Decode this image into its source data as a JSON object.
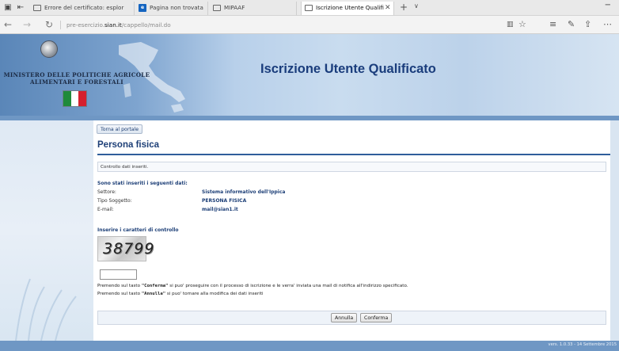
{
  "browser": {
    "tabs": [
      {
        "label": "Errore del certificato: esplor",
        "active": false
      },
      {
        "label": "Pagina non trovata",
        "active": false
      },
      {
        "label": "MIPAAF",
        "active": false
      },
      {
        "label": "Iscrizione Utente Qualifi",
        "active": true
      }
    ],
    "url_prefix": "pre-esercizio.",
    "url_domain": "sian.it",
    "url_path": "/cappello/mail.do",
    "icons": {
      "back": "back-arrow-icon",
      "forward": "forward-arrow-icon",
      "refresh": "refresh-icon",
      "reading_view": "reading-view-icon",
      "favorites": "star-icon",
      "hub": "hub-icon",
      "notes": "pen-icon",
      "share": "share-icon",
      "more": "more-icon"
    }
  },
  "banner": {
    "ministry_line1": "MINISTERO DELLE POLITICHE AGRICOLE",
    "ministry_line2": "ALIMENTARI E FORESTALI",
    "title": "Iscrizione Utente Qualificato",
    "flag_colors": [
      "#1f8a3a",
      "#ffffff",
      "#d5202d"
    ]
  },
  "page": {
    "portal_button": "Torna al portale",
    "section_title": "Persona fisica",
    "notice": "Controllo dati inseriti.",
    "summary_head": "Sono stati inseriti i seguenti dati:",
    "rows": [
      {
        "label": "Settore:",
        "value": "Sistema informativo dell'Ippica"
      },
      {
        "label": "Tipo Soggetto:",
        "value": "PERSONA FISICA"
      },
      {
        "label": "E-mail:",
        "value": "mail@sian1.it"
      }
    ],
    "captcha_head": "Inserire i caratteri di controllo",
    "captcha_text": "38799",
    "captcha_value": "",
    "help1_pre": "Premendo sul tasto ",
    "help1_key": "\"Conferma\"",
    "help1_post": " si puo' proseguire con il processo di iscrizione e le verra' inviata una mail di notifica all'indirizzo specificato.",
    "help2_pre": "Premendo sul tasto ",
    "help2_key": "\"Annulla\"",
    "help2_post": " si puo' tornare alla modifica dei dati inseriti",
    "cancel_button": "Annulla",
    "confirm_button": "Conferma"
  },
  "footer": {
    "version": "vers. 1.0.33 - 14 Settembre 2015"
  },
  "colors": {
    "accent": "#1d3f77",
    "stripe": "#6f97c4"
  }
}
